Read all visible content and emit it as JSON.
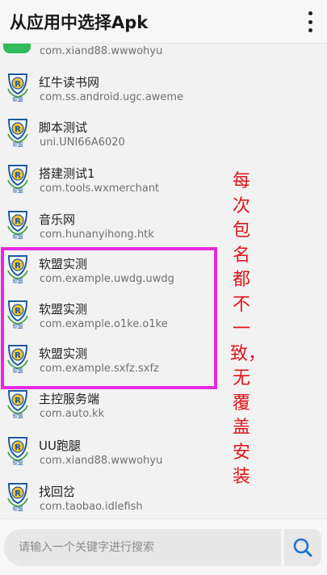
{
  "header": {
    "title": "从应用中选择Apk"
  },
  "list": {
    "top_partial_package": "com.xiand88.wwwohyu",
    "apps": [
      {
        "name": "红牛读书网",
        "package": "com.ss.android.ugc.aweme"
      },
      {
        "name": "脚本测试",
        "package": "uni.UNI66A6020"
      },
      {
        "name": "搭建测试1",
        "package": "com.tools.wxmerchant"
      },
      {
        "name": "音乐网",
        "package": "com.hunanyihong.htk"
      },
      {
        "name": "软盟实测",
        "package": "com.example.uwdg.uwdg"
      },
      {
        "name": "软盟实测",
        "package": "com.example.o1ke.o1ke"
      },
      {
        "name": "软盟实测",
        "package": "com.example.sxfz.sxfz"
      },
      {
        "name": "主控服务端",
        "package": "com.auto.kk"
      },
      {
        "name": "UU跑腿",
        "package": "com.xiand88.wwwohyu"
      },
      {
        "name": "找回岔",
        "package": "com.taobao.idlefish"
      }
    ],
    "logo_text": "软盟",
    "logo_letter": "R"
  },
  "annotation": {
    "text": "每次包名都不一致，无覆盖安装"
  },
  "search": {
    "placeholder": "请输入一个关键字进行搜索",
    "icon": "search-icon"
  },
  "colors": {
    "highlight": "#e629e0",
    "annotation": "#e0151b",
    "logo_blue": "#1c5a9e",
    "logo_green": "#2e9b3a"
  }
}
